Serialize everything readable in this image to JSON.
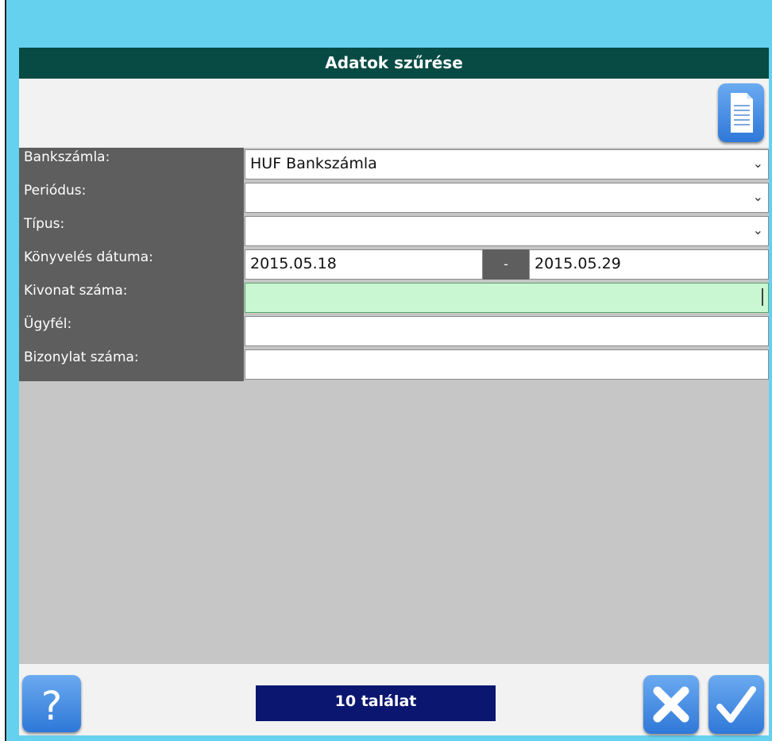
{
  "dialog": {
    "title": "Adatok szűrése"
  },
  "toolbar": {
    "document_icon": "document-icon"
  },
  "fields": {
    "bankszamla": {
      "label": "Bankszámla:",
      "value": "HUF Bankszámla"
    },
    "periodus": {
      "label": "Periódus:",
      "value": ""
    },
    "tipus": {
      "label": "Típus:",
      "value": ""
    },
    "konyveles": {
      "label": "Könyvelés dátuma:",
      "from": "2015.05.18",
      "separator": "-",
      "to": "2015.05.29"
    },
    "kivonat": {
      "label": "Kivonat száma:",
      "value": ""
    },
    "ugyfel": {
      "label": "Ügyfél:",
      "value": ""
    },
    "bizonylat": {
      "label": "Bizonylat száma:",
      "value": ""
    }
  },
  "footer": {
    "status": "10 találat",
    "help_icon": "help-icon",
    "cancel_icon": "close-icon",
    "ok_icon": "checkmark-icon"
  },
  "colors": {
    "frame": "#66d1ef",
    "title_bar": "#074b44",
    "label_bg": "#5e5e5e",
    "active_field": "#c9f7d1",
    "status_bg": "#0b1670",
    "button": "#2f78d8"
  }
}
